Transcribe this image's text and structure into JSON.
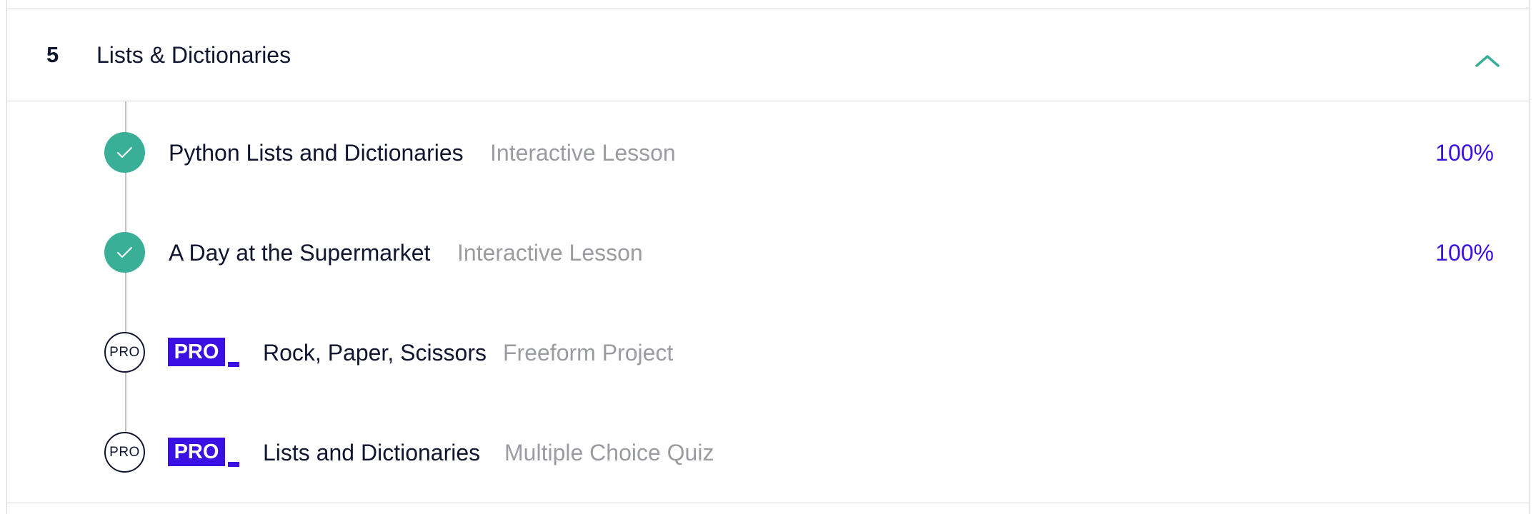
{
  "section": {
    "number": "5",
    "title": "Lists & Dictionaries",
    "toggle_icon": "chevron-up-icon",
    "colors": {
      "accent": "#3aaf97",
      "pro": "#3a10e5",
      "text": "#10162f",
      "muted": "#9a9ca2"
    }
  },
  "items": [
    {
      "status": "completed",
      "icon": "checkmark-icon",
      "title": "Python Lists and Dictionaries",
      "type": "Interactive Lesson",
      "progress": "100%"
    },
    {
      "status": "completed",
      "icon": "checkmark-icon",
      "title": "A Day at the Supermarket",
      "type": "Interactive Lesson",
      "progress": "100%"
    },
    {
      "status": "locked",
      "icon_label": "PRO",
      "badge": "PRO",
      "title": "Rock, Paper, Scissors",
      "type": "Freeform Project"
    },
    {
      "status": "locked",
      "icon_label": "PRO",
      "badge": "PRO",
      "title": "Lists and Dictionaries",
      "type": "Multiple Choice Quiz"
    }
  ]
}
